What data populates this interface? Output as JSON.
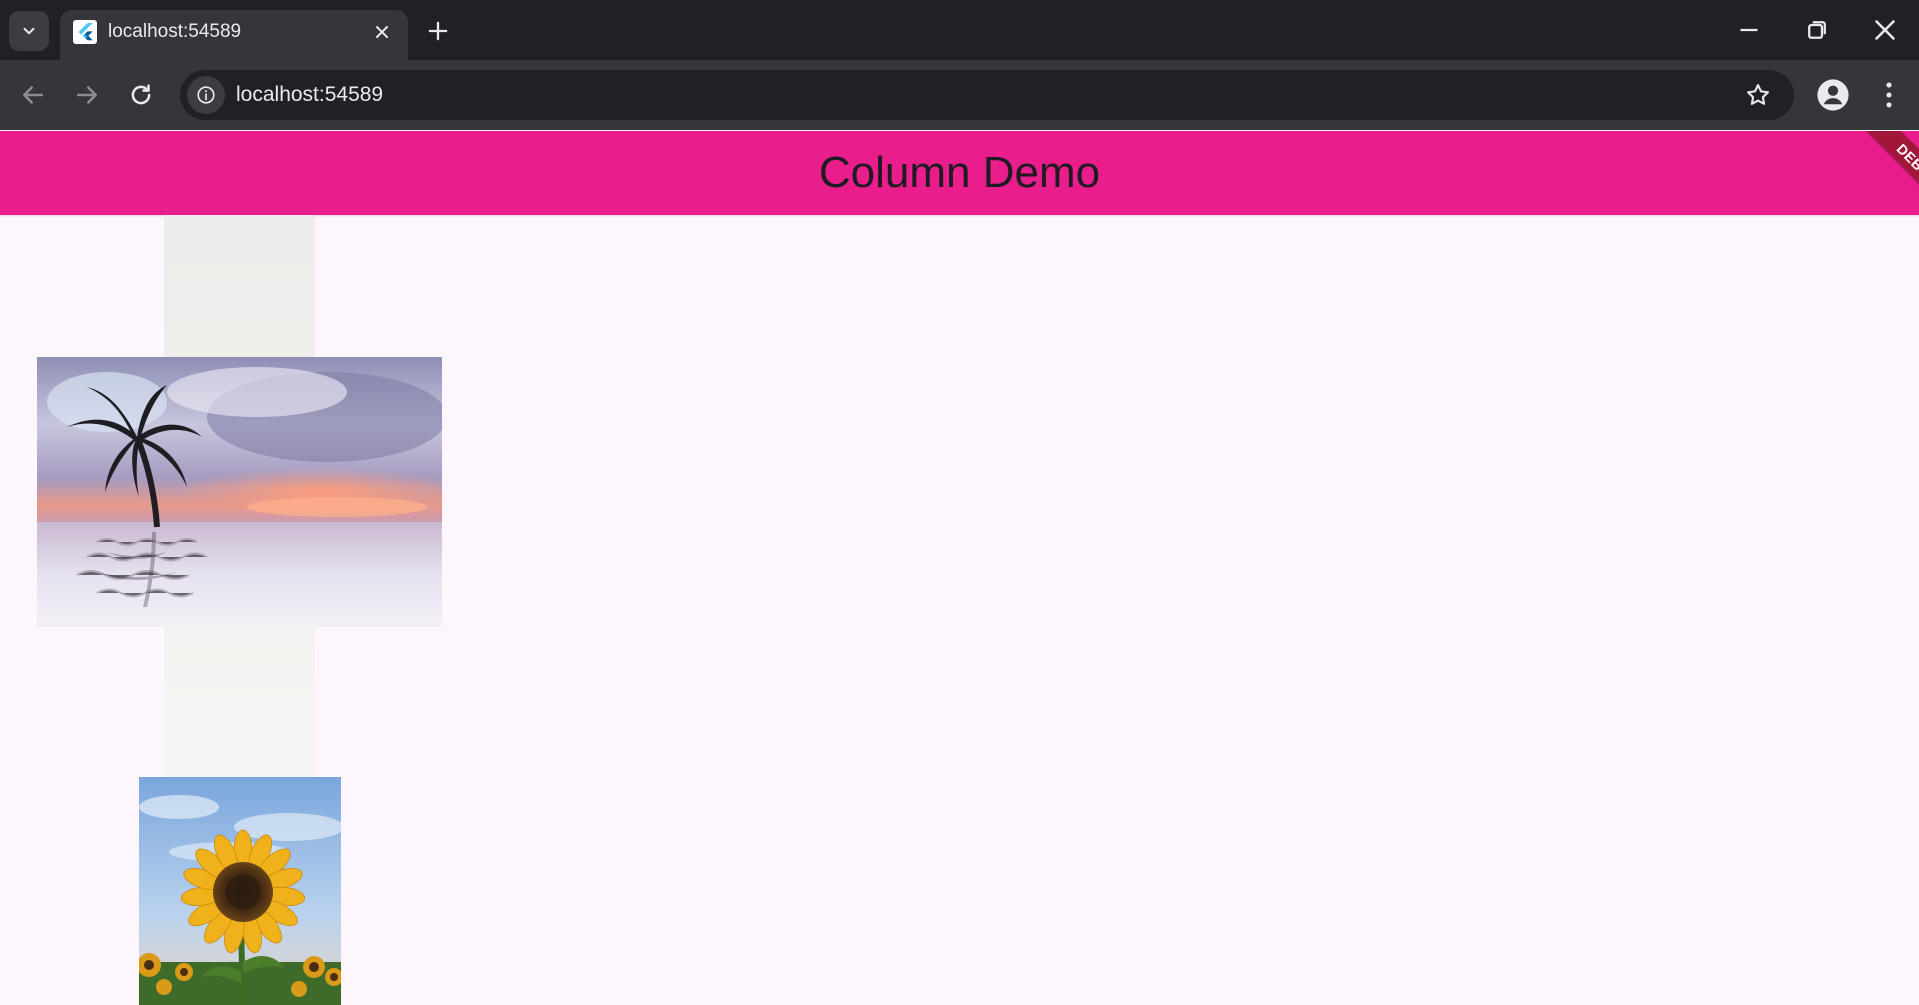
{
  "browser": {
    "tab": {
      "title": "localhost:54589"
    },
    "address_bar": {
      "url": "localhost:54589"
    },
    "window_controls": [
      "minimize-icon",
      "restore-icon",
      "close-icon"
    ]
  },
  "app": {
    "title": "Column Demo",
    "debug_banner": "DEBUG",
    "colors": {
      "app_bar": "#e91e8c",
      "background": "#fdf7fd",
      "debug_ribbon": "#a2163a"
    },
    "images": [
      {
        "name": "palm-tree-sunset-image"
      },
      {
        "name": "sunflower-image"
      }
    ]
  }
}
